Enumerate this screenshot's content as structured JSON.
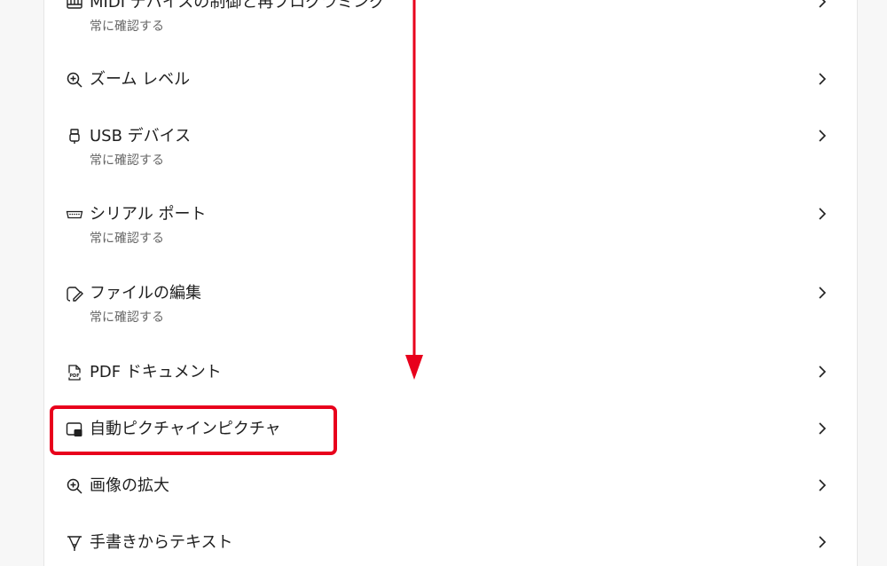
{
  "colors": {
    "accent": "#e8001c",
    "text": "#1f1f1f",
    "subtext": "#666666",
    "background": "#f7f7f7",
    "panel": "#ffffff"
  },
  "settings": {
    "items": [
      {
        "title": "MIDI デバイスの制御と再プログラミング",
        "subtitle": "常に確認する",
        "icon": "piano-icon"
      },
      {
        "title": "ズーム レベル",
        "subtitle": "",
        "icon": "zoom-in-icon"
      },
      {
        "title": "USB デバイス",
        "subtitle": "常に確認する",
        "icon": "usb-icon"
      },
      {
        "title": "シリアル ポート",
        "subtitle": "常に確認する",
        "icon": "serial-port-icon"
      },
      {
        "title": "ファイルの編集",
        "subtitle": "常に確認する",
        "icon": "file-edit-icon"
      },
      {
        "title": "PDF ドキュメント",
        "subtitle": "",
        "icon": "pdf-icon"
      },
      {
        "title": "自動ピクチャインピクチャ",
        "subtitle": "",
        "icon": "picture-in-picture-icon"
      },
      {
        "title": "画像の拡大",
        "subtitle": "",
        "icon": "image-zoom-icon"
      },
      {
        "title": "手書きからテキスト",
        "subtitle": "",
        "icon": "handwriting-icon"
      }
    ]
  }
}
